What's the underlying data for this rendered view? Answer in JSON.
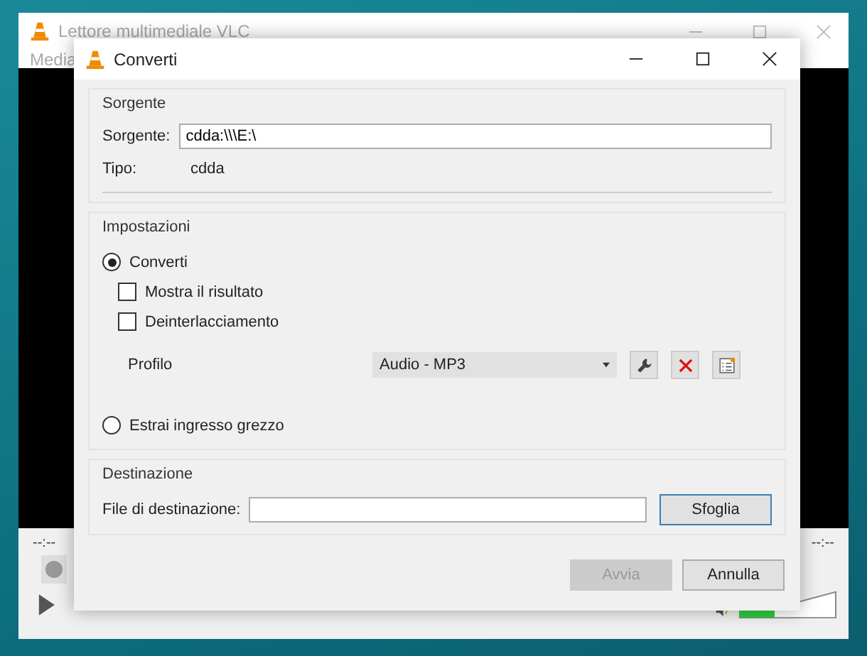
{
  "background_window": {
    "title": "Lettore multimediale VLC",
    "menu": [
      "Media"
    ],
    "elapsed": "--:--",
    "total": "--:--",
    "volume": {
      "level": 0.35
    }
  },
  "dialog": {
    "title": "Converti",
    "source": {
      "group_title": "Sorgente",
      "label": "Sorgente:",
      "value": "cdda:\\\\\\E:\\",
      "type_label": "Tipo:",
      "type_value": "cdda"
    },
    "settings": {
      "group_title": "Impostazioni",
      "options": [
        {
          "label": "Converti",
          "selected": true
        },
        {
          "label": "Estrai ingresso grezzo",
          "selected": false
        }
      ],
      "checkboxes": [
        {
          "label": "Mostra il risultato",
          "checked": false
        },
        {
          "label": "Deinterlacciamento",
          "checked": false
        }
      ],
      "profile_label": "Profilo",
      "profile_value": "Audio - MP3"
    },
    "destination": {
      "group_title": "Destinazione",
      "label": "File di destinazione:",
      "browse": "Sfoglia"
    },
    "buttons": [
      {
        "label": "Avvia",
        "disabled": true
      },
      {
        "label": "Annulla",
        "disabled": false
      }
    ]
  }
}
